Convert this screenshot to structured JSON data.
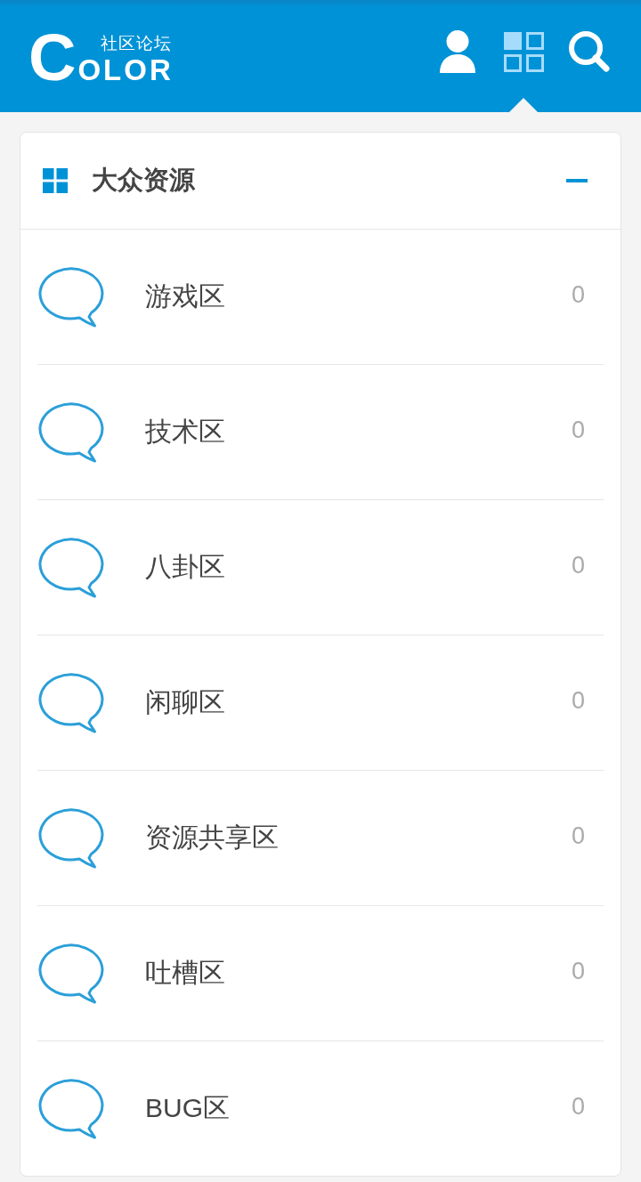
{
  "header": {
    "logo": {
      "initial": "C",
      "wordmark": "OLOR",
      "tagline": "社区论坛"
    },
    "nav": [
      {
        "kind": "user",
        "selected": false
      },
      {
        "kind": "grid",
        "selected": true
      },
      {
        "kind": "search",
        "selected": false
      }
    ]
  },
  "section": {
    "title": "大众资源",
    "expanded": true,
    "boards": [
      {
        "name": "游戏区",
        "count": "0"
      },
      {
        "name": "技术区",
        "count": "0"
      },
      {
        "name": "八卦区",
        "count": "0"
      },
      {
        "name": "闲聊区",
        "count": "0"
      },
      {
        "name": "资源共享区",
        "count": "0"
      },
      {
        "name": "吐槽区",
        "count": "0"
      },
      {
        "name": "BUG区",
        "count": "0"
      }
    ]
  }
}
